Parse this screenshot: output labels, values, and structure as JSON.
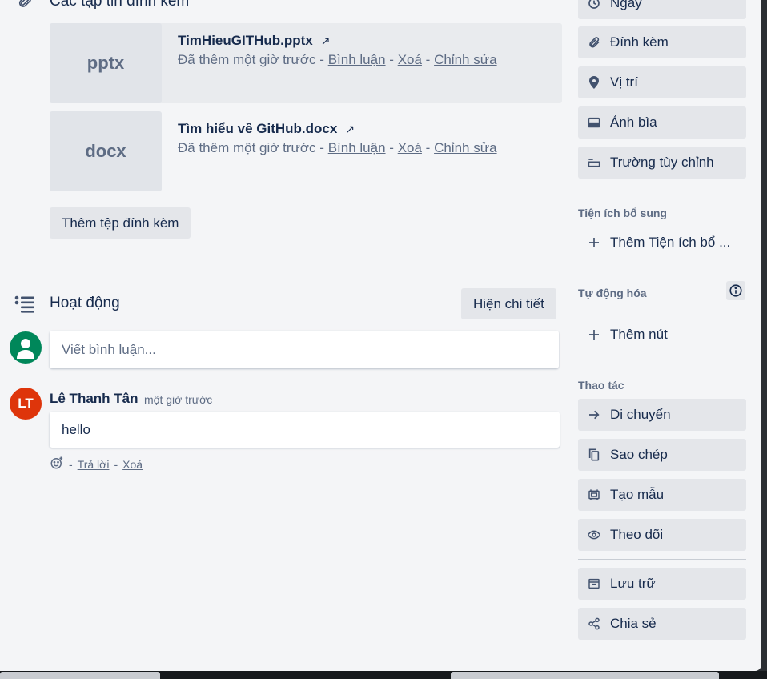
{
  "attachments": {
    "title": "Các tập tin đính kèm",
    "items": [
      {
        "thumb": "pptx",
        "name": "TimHieuGITHub.pptx",
        "added": "Đã thêm một giờ trước",
        "comment": "Bình luận",
        "delete": "Xoá",
        "edit": "Chỉnh sửa"
      },
      {
        "thumb": "docx",
        "name": "Tìm hiểu về GitHub.docx",
        "added": "Đã thêm một giờ trước",
        "comment": "Bình luận",
        "delete": "Xoá",
        "edit": "Chỉnh sửa"
      }
    ],
    "add_label": "Thêm tệp đính kèm",
    "separator": "-",
    "external_icon": "arrow-up-right-icon"
  },
  "activity": {
    "title": "Hoạt động",
    "show_details_label": "Hiện chi tiết",
    "comment_placeholder": "Viết bình luận...",
    "comments": [
      {
        "initials": "LT",
        "author": "Lê Thanh Tân",
        "time": "một giờ trước",
        "text": "hello",
        "reply": "Trả lời",
        "delete": "Xoá"
      }
    ]
  },
  "sidebar": {
    "card_items": [
      {
        "label": "Ngày",
        "icon": "clock-icon"
      },
      {
        "label": "Đính kèm",
        "icon": "paperclip-icon"
      },
      {
        "label": "Vị trí",
        "icon": "location-pin-icon"
      },
      {
        "label": "Ảnh bìa",
        "icon": "card-cover-icon"
      },
      {
        "label": "Trường tùy chỉnh",
        "icon": "custom-field-icon"
      }
    ],
    "powerups": {
      "title": "Tiện ích bổ sung",
      "add_label": "Thêm Tiện ích bổ ..."
    },
    "automation": {
      "title": "Tự động hóa",
      "add_label": "Thêm nút"
    },
    "actions": {
      "title": "Thao tác",
      "items": [
        {
          "label": "Di chuyển",
          "icon": "arrow-right-icon"
        },
        {
          "label": "Sao chép",
          "icon": "copy-icon"
        },
        {
          "label": "Tạo mẫu",
          "icon": "template-icon"
        },
        {
          "label": "Theo dõi",
          "icon": "eye-icon"
        },
        {
          "label": "Lưu trữ",
          "icon": "archive-icon"
        },
        {
          "label": "Chia sẻ",
          "icon": "share-icon"
        }
      ]
    }
  },
  "colors": {
    "avatar_user": "#00875a",
    "avatar_lt": "#de350b",
    "button_bg": "#e4e6ea",
    "panel_bg": "#f4f5f7"
  }
}
